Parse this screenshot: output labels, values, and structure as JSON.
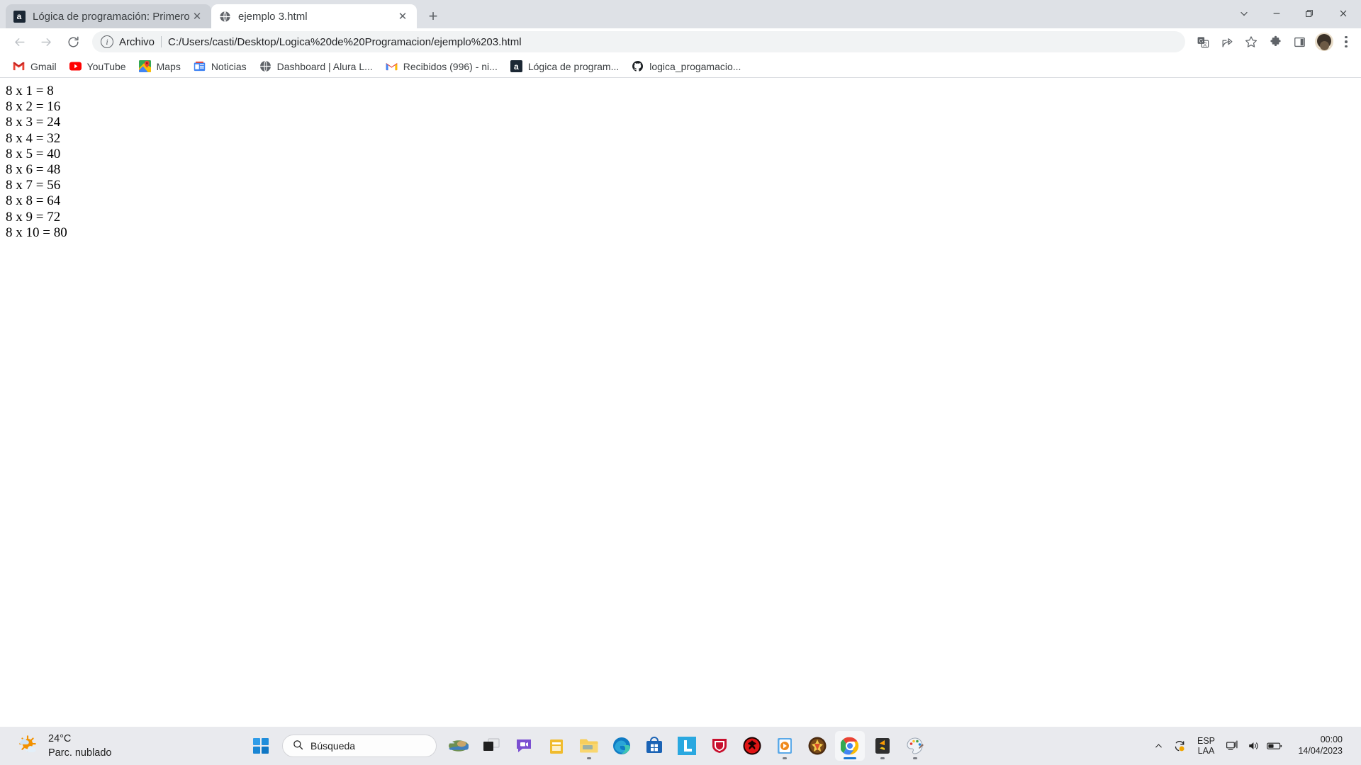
{
  "window": {
    "controls": {
      "tab_search": "tab-search",
      "minimize": "minimize",
      "restore": "restore",
      "close": "close"
    }
  },
  "tabs": [
    {
      "title": "Lógica de programación: Primero",
      "favicon": "alura-icon",
      "active": false,
      "close_label": "✕"
    },
    {
      "title": "ejemplo 3.html",
      "favicon": "globe-icon",
      "active": true,
      "close_label": "✕"
    }
  ],
  "new_tab_label": "+",
  "toolbar": {
    "back_label": "←",
    "forward_label": "→",
    "reload_label": "⟳",
    "omnibox": {
      "scheme_label": "Archivo",
      "url": "C:/Users/casti/Desktop/Logica%20de%20Programacion/ejemplo%203.html",
      "info_glyph": "i"
    },
    "icons": [
      "translate-icon",
      "share-icon",
      "bookmark-star-icon",
      "extensions-puzzle-icon",
      "side-panel-icon"
    ],
    "profile_label": "profile-avatar",
    "menu_label": "chrome-menu"
  },
  "bookmarks": [
    {
      "label": "Gmail",
      "icon": "gmail-icon"
    },
    {
      "label": "YouTube",
      "icon": "youtube-icon"
    },
    {
      "label": "Maps",
      "icon": "google-maps-icon"
    },
    {
      "label": "Noticias",
      "icon": "google-news-icon"
    },
    {
      "label": "Dashboard | Alura L...",
      "icon": "globe-icon"
    },
    {
      "label": "Recibidos (996) - ni...",
      "icon": "gmail-icon"
    },
    {
      "label": "Lógica de program...",
      "icon": "alura-icon"
    },
    {
      "label": "logica_progamacio...",
      "icon": "github-icon"
    }
  ],
  "page": {
    "lines": [
      "8 x 1 = 8",
      "8 x 2 = 16",
      "8 x 3 = 24",
      "8 x 4 = 32",
      "8 x 5 = 40",
      "8 x 6 = 48",
      "8 x 7 = 56",
      "8 x 8 = 64",
      "8 x 9 = 72",
      "8 x 10 = 80"
    ]
  },
  "taskbar": {
    "weather": {
      "temperature": "24°C",
      "condition": "Parc. nublado",
      "icon": "partly-cloudy-icon"
    },
    "start_label": "start-button",
    "search": {
      "placeholder": "Búsqueda",
      "value": "Búsqueda",
      "icon": "search-icon"
    },
    "apps": [
      {
        "name": "widgets-weather-thumbnail",
        "icon": "weather-thumb-icon",
        "running": false,
        "active": false
      },
      {
        "name": "task-view",
        "icon": "task-view-icon",
        "running": false,
        "active": false
      },
      {
        "name": "chat-teams",
        "icon": "chat-icon",
        "running": false,
        "active": false
      },
      {
        "name": "microsoft-store-yellow",
        "icon": "store-yellow-icon",
        "running": false,
        "active": false
      },
      {
        "name": "file-explorer",
        "icon": "folder-icon",
        "running": true,
        "active": false
      },
      {
        "name": "microsoft-edge",
        "icon": "edge-icon",
        "running": false,
        "active": false
      },
      {
        "name": "microsoft-store",
        "icon": "store-icon",
        "running": false,
        "active": false
      },
      {
        "name": "linio-app",
        "icon": "letter-l-icon",
        "running": false,
        "active": false
      },
      {
        "name": "mcafee",
        "icon": "shield-icon",
        "running": false,
        "active": false
      },
      {
        "name": "crossfire-red",
        "icon": "red-circle-icon",
        "running": false,
        "active": false
      },
      {
        "name": "media-player",
        "icon": "media-player-icon",
        "running": true,
        "active": false
      },
      {
        "name": "crossfire",
        "icon": "crossfire-icon",
        "running": false,
        "active": false
      },
      {
        "name": "google-chrome",
        "icon": "chrome-icon",
        "running": true,
        "active": true
      },
      {
        "name": "sublime-text",
        "icon": "sublime-icon",
        "running": true,
        "active": false
      },
      {
        "name": "paint",
        "icon": "paint-icon",
        "running": true,
        "active": false
      }
    ],
    "tray": {
      "overflow_label": "⌃",
      "sync_icon": "sync-icon",
      "language_line1": "ESP",
      "language_line2": "LAA",
      "network_icon": "network-icon",
      "volume_icon": "volume-icon",
      "battery_icon": "battery-icon"
    },
    "clock": {
      "time": "00:00",
      "date": "14/04/2023"
    }
  },
  "colors": {
    "tabstrip_bg": "#dee1e6",
    "inactive_tab": "#cdd1d7",
    "omnibox_bg": "#f1f3f4",
    "taskbar_bg": "#e9eaee",
    "accent_blue": "#1976d2"
  }
}
